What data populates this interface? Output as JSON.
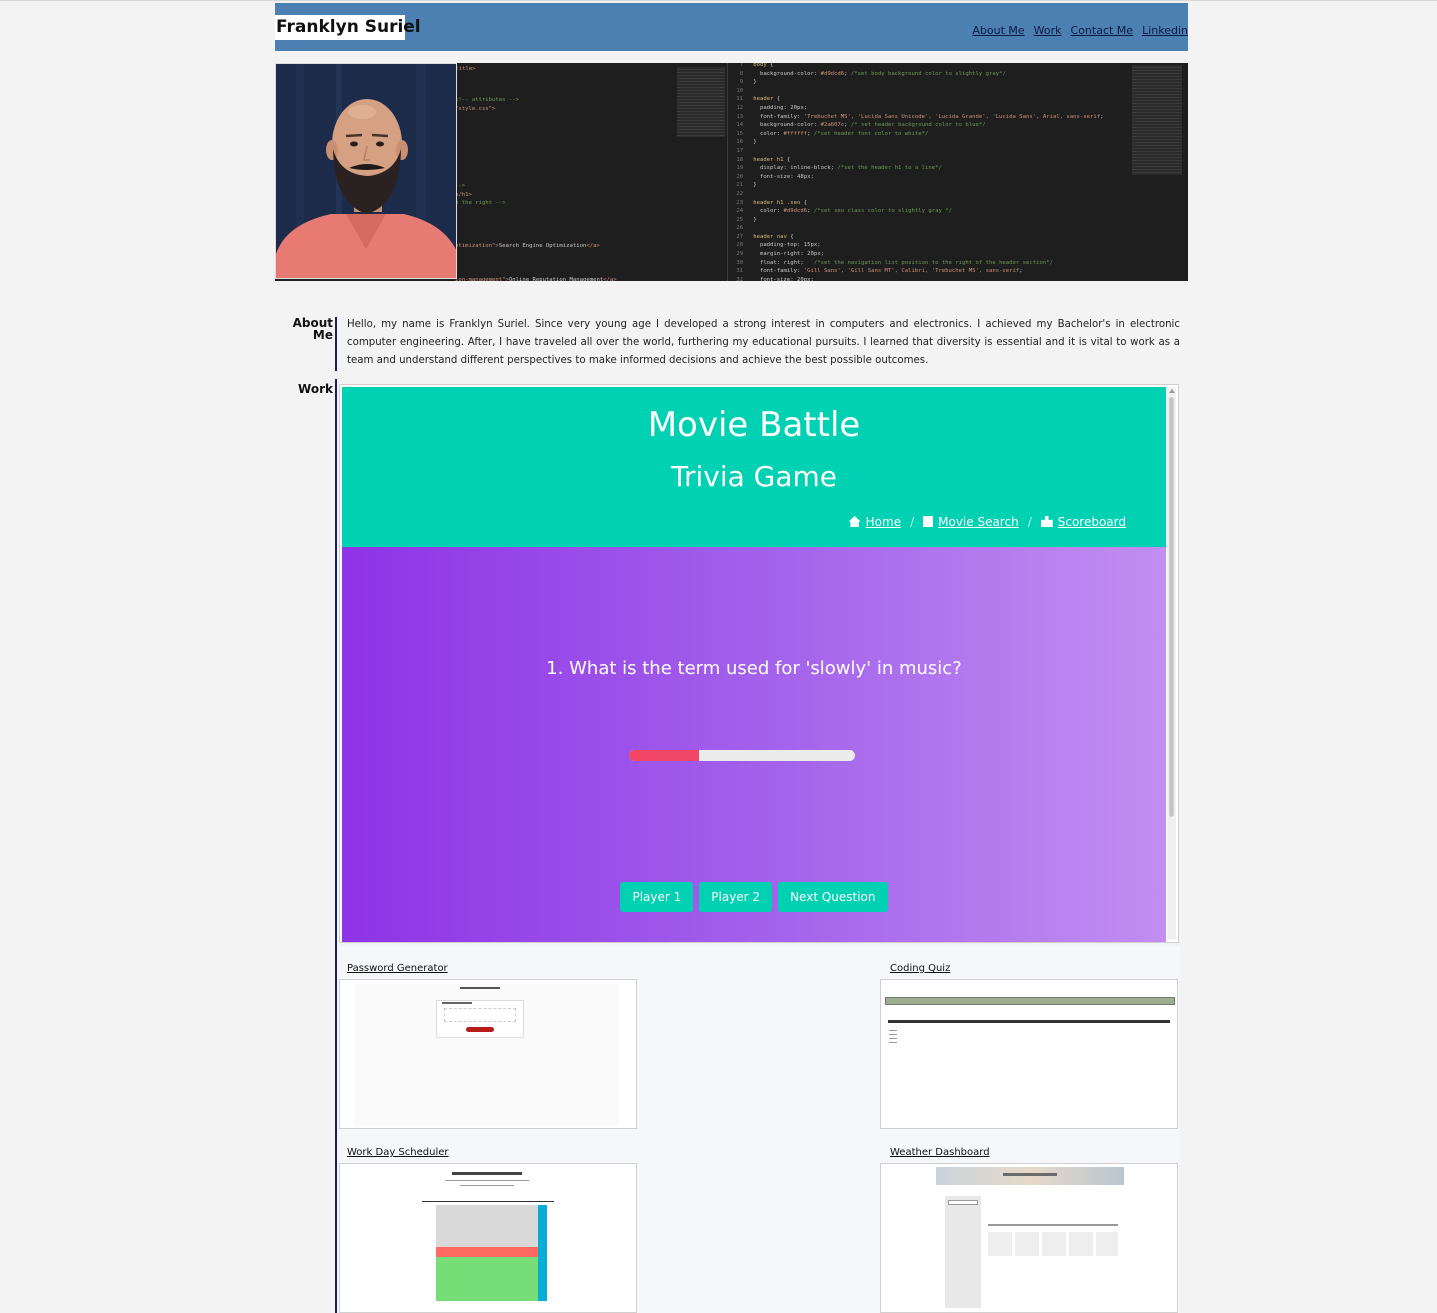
{
  "header": {
    "brand": "Franklyn Suriel",
    "nav": [
      "About Me",
      "Work",
      "Contact Me",
      "Linkedin"
    ]
  },
  "sections": {
    "about_label": "About Me",
    "work_label": "Work"
  },
  "about": {
    "text": "Hello, my name is Franklyn Suriel. Since very young age I developed a strong interest in computers and electronics. I achieved my Bachelor's in electronic computer engineering. After, I have traveled all over the world, furthering my educational pursuits. I learned that diversity is essential and it is vital to work as a team and understand different perspectives to make informed decisions and achieve the best possible outcomes."
  },
  "featured": {
    "title": "Movie Battle",
    "subtitle": "Trivia Game",
    "breadcrumbs": [
      "Home",
      "Movie Search",
      "Scoreboard"
    ],
    "question": "1. What is the term used for 'slowly' in music?",
    "progress_fraction": 0.31,
    "buttons": [
      "Player 1",
      "Player 2",
      "Next Question"
    ]
  },
  "projects": [
    {
      "label": "Password Generator"
    },
    {
      "label": "Coding Quiz"
    },
    {
      "label": "Work Day Scheduler"
    },
    {
      "label": "Weather Dashboard"
    }
  ],
  "colors": {
    "header": "#4c80b3",
    "teal": "#00d1b2",
    "purple_start": "#8e33e6",
    "purple_end": "#c28ef1",
    "progress": "#f14668"
  }
}
